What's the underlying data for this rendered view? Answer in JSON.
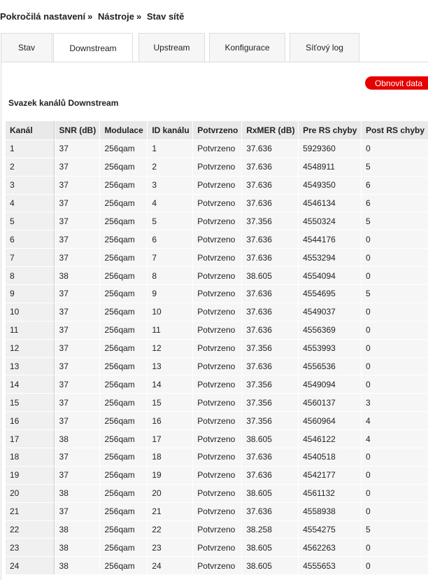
{
  "breadcrumb": {
    "items": [
      "Pokročilá nastavení",
      "Nástroje",
      "Stav sítě"
    ],
    "separator": "»"
  },
  "tabs": [
    {
      "label": "Stav",
      "active": false
    },
    {
      "label": "Downstream",
      "active": true
    },
    {
      "label": "Upstream",
      "active": false
    },
    {
      "label": "Konfigurace",
      "active": false
    },
    {
      "label": "Síťový log",
      "active": false
    }
  ],
  "actions": {
    "refresh_label": "Obnovit data"
  },
  "colors": {
    "accent": "#e60000"
  },
  "section": {
    "title": "Svazek kanálů Downstream"
  },
  "table": {
    "headers": [
      "Kanál",
      "SNR (dB)",
      "Modulace",
      "ID kanálu",
      "Potvrzeno",
      "RxMER (dB)",
      "Pre RS chyby",
      "Post RS chyby"
    ],
    "rows": [
      [
        "1",
        "37",
        "256qam",
        "1",
        "Potvrzeno",
        "37.636",
        "5929360",
        "0"
      ],
      [
        "2",
        "37",
        "256qam",
        "2",
        "Potvrzeno",
        "37.636",
        "4548911",
        "5"
      ],
      [
        "3",
        "37",
        "256qam",
        "3",
        "Potvrzeno",
        "37.636",
        "4549350",
        "6"
      ],
      [
        "4",
        "37",
        "256qam",
        "4",
        "Potvrzeno",
        "37.636",
        "4546134",
        "6"
      ],
      [
        "5",
        "37",
        "256qam",
        "5",
        "Potvrzeno",
        "37.356",
        "4550324",
        "5"
      ],
      [
        "6",
        "37",
        "256qam",
        "6",
        "Potvrzeno",
        "37.636",
        "4544176",
        "0"
      ],
      [
        "7",
        "37",
        "256qam",
        "7",
        "Potvrzeno",
        "37.636",
        "4553294",
        "0"
      ],
      [
        "8",
        "38",
        "256qam",
        "8",
        "Potvrzeno",
        "38.605",
        "4554094",
        "0"
      ],
      [
        "9",
        "37",
        "256qam",
        "9",
        "Potvrzeno",
        "37.636",
        "4554695",
        "5"
      ],
      [
        "10",
        "37",
        "256qam",
        "10",
        "Potvrzeno",
        "37.636",
        "4549037",
        "0"
      ],
      [
        "11",
        "37",
        "256qam",
        "11",
        "Potvrzeno",
        "37.636",
        "4556369",
        "0"
      ],
      [
        "12",
        "37",
        "256qam",
        "12",
        "Potvrzeno",
        "37.356",
        "4553993",
        "0"
      ],
      [
        "13",
        "37",
        "256qam",
        "13",
        "Potvrzeno",
        "37.636",
        "4556536",
        "0"
      ],
      [
        "14",
        "37",
        "256qam",
        "14",
        "Potvrzeno",
        "37.356",
        "4549094",
        "0"
      ],
      [
        "15",
        "37",
        "256qam",
        "15",
        "Potvrzeno",
        "37.356",
        "4560137",
        "3"
      ],
      [
        "16",
        "37",
        "256qam",
        "16",
        "Potvrzeno",
        "37.356",
        "4560964",
        "4"
      ],
      [
        "17",
        "38",
        "256qam",
        "17",
        "Potvrzeno",
        "38.605",
        "4546122",
        "4"
      ],
      [
        "18",
        "37",
        "256qam",
        "18",
        "Potvrzeno",
        "37.636",
        "4540518",
        "0"
      ],
      [
        "19",
        "37",
        "256qam",
        "19",
        "Potvrzeno",
        "37.636",
        "4542177",
        "0"
      ],
      [
        "20",
        "38",
        "256qam",
        "20",
        "Potvrzeno",
        "38.605",
        "4561132",
        "0"
      ],
      [
        "21",
        "37",
        "256qam",
        "21",
        "Potvrzeno",
        "37.636",
        "4558938",
        "0"
      ],
      [
        "22",
        "38",
        "256qam",
        "22",
        "Potvrzeno",
        "38.258",
        "4554275",
        "5"
      ],
      [
        "23",
        "38",
        "256qam",
        "23",
        "Potvrzeno",
        "38.605",
        "4562263",
        "0"
      ],
      [
        "24",
        "38",
        "256qam",
        "24",
        "Potvrzeno",
        "38.605",
        "4555653",
        "0"
      ]
    ]
  }
}
